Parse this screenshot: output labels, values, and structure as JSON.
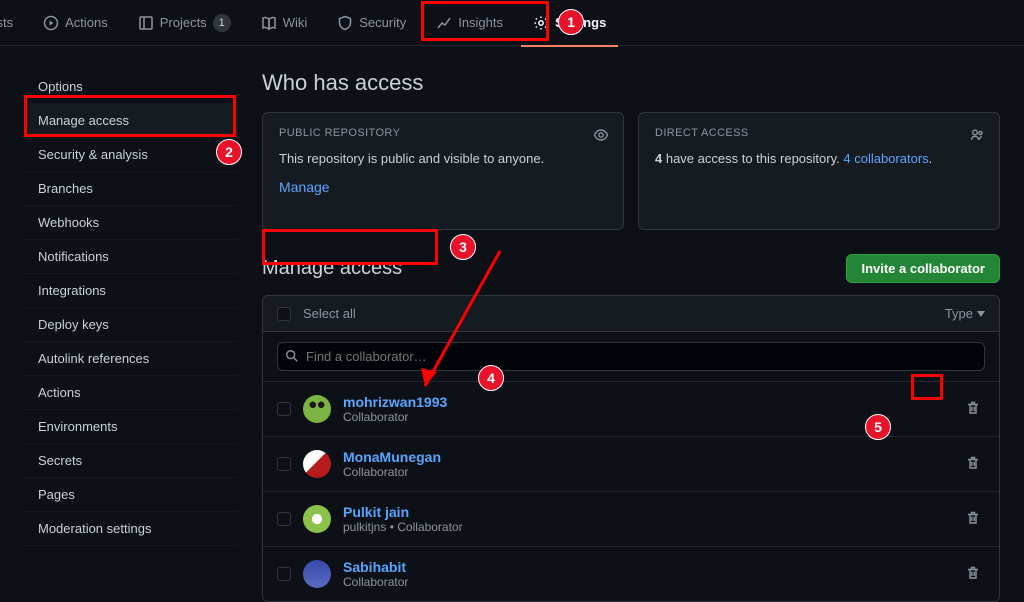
{
  "topnav": {
    "tabs": [
      {
        "label": "uests"
      },
      {
        "label": "Actions"
      },
      {
        "label": "Projects",
        "count": "1"
      },
      {
        "label": "Wiki"
      },
      {
        "label": "Security"
      },
      {
        "label": "Insights"
      },
      {
        "label": "Settings"
      }
    ]
  },
  "sidebar": {
    "items": [
      "Options",
      "Manage access",
      "Security & analysis",
      "Branches",
      "Webhooks",
      "Notifications",
      "Integrations",
      "Deploy keys",
      "Autolink references",
      "Actions",
      "Environments",
      "Secrets",
      "Pages",
      "Moderation settings"
    ]
  },
  "main": {
    "page_title": "Who has access",
    "public_card": {
      "title": "PUBLIC REPOSITORY",
      "text": "This repository is public and visible to anyone.",
      "manage": "Manage"
    },
    "direct_card": {
      "title": "DIRECT ACCESS",
      "count": "4",
      "text_mid": " have access to this repository. ",
      "link_count": "4",
      "link_text": "collaborators",
      "period": "."
    },
    "manage_section": {
      "title": "Manage access",
      "invite_label": "Invite a collaborator",
      "select_all": "Select all",
      "type_label": "Type",
      "search_placeholder": "Find a collaborator…"
    },
    "collaborators": [
      {
        "name": "mohrizwan1993",
        "role": "Collaborator",
        "avatar_bg": "#7cb342",
        "avatar_fg": "#0d1117"
      },
      {
        "name": "MonaMunegan",
        "role": "Collaborator",
        "avatar_bg": "#fff",
        "avatar_fg": "#b71c1c"
      },
      {
        "name": "Pulkit jain",
        "role": "pulkitjns • Collaborator",
        "avatar_bg": "#8bc34a",
        "avatar_fg": "#fff"
      },
      {
        "name": "Sabihabit",
        "role": "Collaborator",
        "avatar_bg": "#3949ab",
        "avatar_fg": "#fff"
      }
    ]
  }
}
